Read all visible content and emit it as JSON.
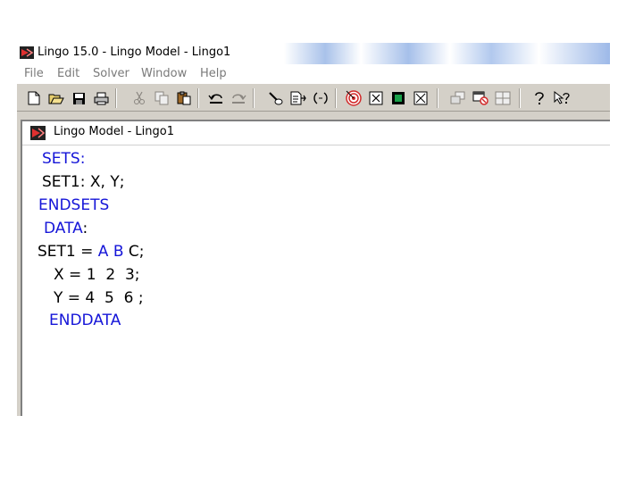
{
  "window": {
    "title": "Lingo 15.0 - Lingo Model - Lingo1"
  },
  "menu": [
    "File",
    "Edit",
    "Solver",
    "Window",
    "Help"
  ],
  "toolbar": {
    "groups": [
      [
        "new-icon",
        "open-icon",
        "save-icon",
        "print-icon"
      ],
      [
        "cut-icon",
        "copy-icon",
        "paste-icon"
      ],
      [
        "undo-icon",
        "redo-icon"
      ],
      [
        "find-icon",
        "goto-line-icon",
        "match-parenthesis-icon"
      ],
      [
        "solve-icon",
        "solution-icon",
        "matrix-picture-icon",
        "options-icon"
      ],
      [
        "send-to-back-icon",
        "close-all-icon",
        "tile-icon"
      ],
      [
        "help-icon",
        "context-help-icon"
      ]
    ],
    "colors": {
      "solve": "#d22a2a",
      "matrix": "#1aa04a"
    }
  },
  "model_window": {
    "title": "Lingo Model - Lingo1"
  },
  "code": {
    "sets_kw": "SETS:",
    "set1_decl": "SET1: X, Y;",
    "endsets_kw": "ENDSETS",
    "data_kw": "DATA",
    "data_colon": ":",
    "set1_assign": "SET1 = ",
    "set1_members_blue": "A B",
    "set1_members_black": " C;",
    "x_line": "X = 1  2  3;",
    "y_line": "Y = 4  5  6 ;",
    "enddata_kw": "ENDDATA"
  },
  "colors": {
    "keyword": "#1515d8",
    "text": "#000000"
  }
}
